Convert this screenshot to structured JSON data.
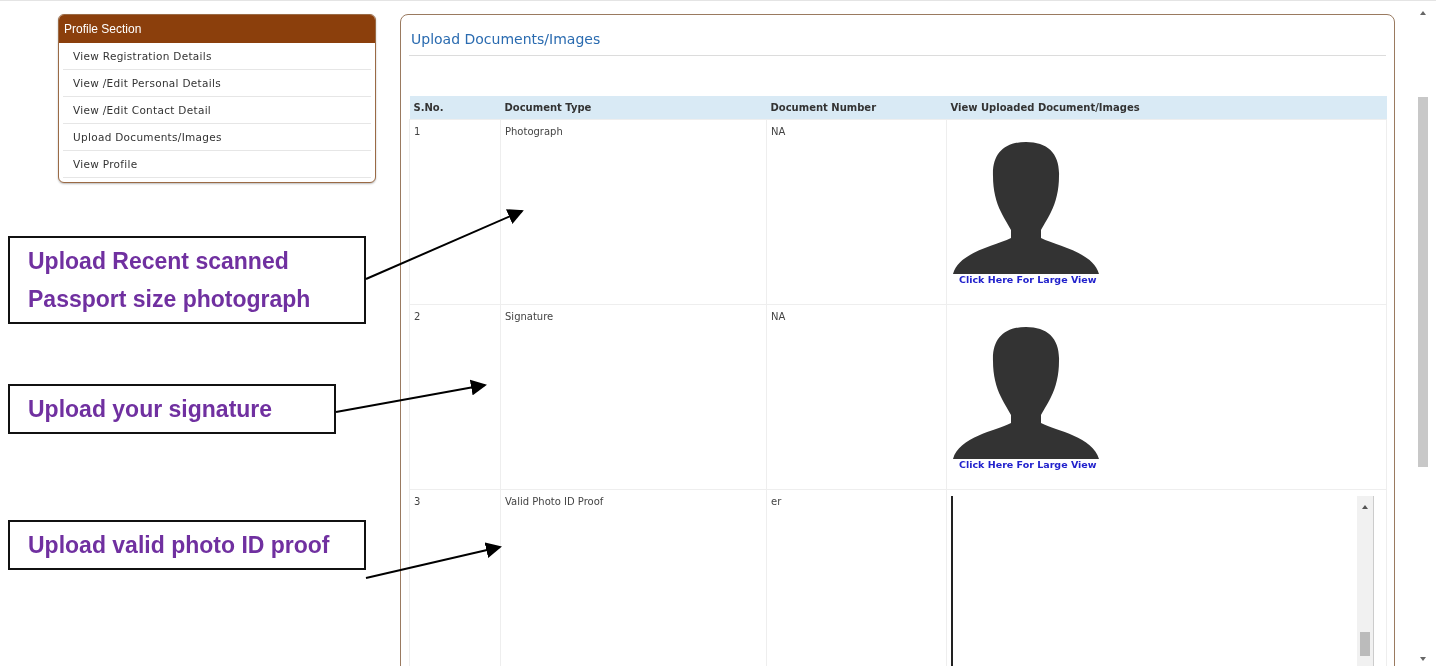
{
  "sidebar": {
    "title": "Profile Section",
    "items": [
      {
        "label": "View Registration Details"
      },
      {
        "label": "View /Edit Personal Details"
      },
      {
        "label": "View /Edit Contact Detail"
      },
      {
        "label": "Upload Documents/Images"
      },
      {
        "label": "View Profile"
      }
    ]
  },
  "panel": {
    "title": "Upload Documents/Images",
    "table": {
      "columns": [
        "S.No.",
        "Document Type",
        "Document Number",
        "View Uploaded Document/Images"
      ],
      "rows": [
        {
          "sno": "1",
          "type": "Photograph",
          "number": "NA",
          "view": {
            "kind": "image",
            "link": "Click Here For Large View"
          }
        },
        {
          "sno": "2",
          "type": "Signature",
          "number": "NA",
          "view": {
            "kind": "image",
            "link": "Click Here For Large View"
          }
        },
        {
          "sno": "3",
          "type": "Valid Photo ID Proof",
          "number": "er",
          "view": {
            "kind": "frame"
          }
        }
      ]
    }
  },
  "callouts": [
    {
      "text": "Upload Recent scanned Passport size photograph"
    },
    {
      "text": "Upload your signature"
    },
    {
      "text": "Upload valid photo ID proof"
    }
  ]
}
